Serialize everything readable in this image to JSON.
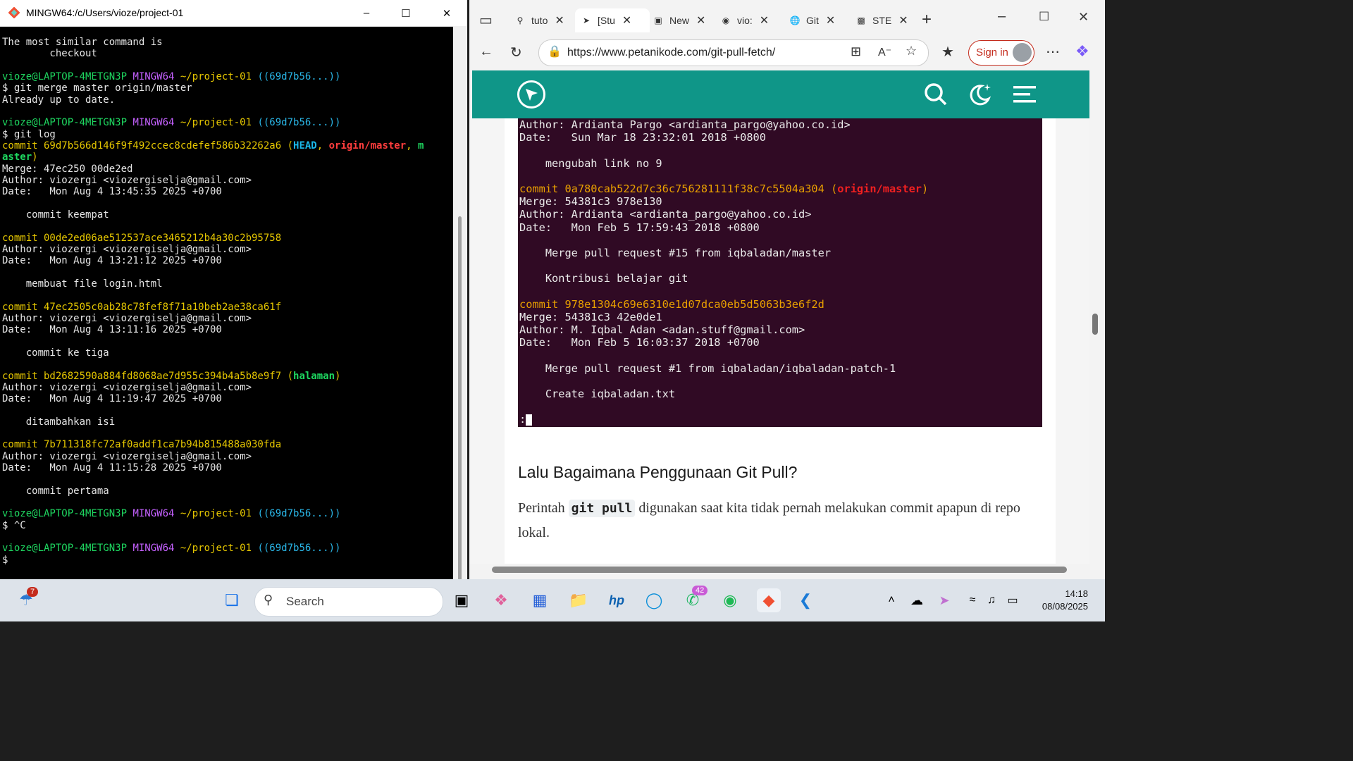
{
  "terminal": {
    "title": "MINGW64:/c/Users/vioze/project-01",
    "lines": [
      [
        [
          "The most similar command is",
          ""
        ]
      ],
      [
        [
          "        checkout",
          ""
        ]
      ],
      [
        [
          "",
          ""
        ]
      ],
      [
        [
          "vioze@LAPTOP-4METGN3P ",
          "c-user"
        ],
        [
          "MINGW64 ",
          "c-sys"
        ],
        [
          "~/project-01 ",
          "c-path"
        ],
        [
          "((69d7b56...))",
          "c-br"
        ]
      ],
      [
        [
          "$ git merge master origin/master",
          ""
        ]
      ],
      [
        [
          "Already up to date.",
          ""
        ]
      ],
      [
        [
          "",
          ""
        ]
      ],
      [
        [
          "vioze@LAPTOP-4METGN3P ",
          "c-user"
        ],
        [
          "MINGW64 ",
          "c-sys"
        ],
        [
          "~/project-01 ",
          "c-path"
        ],
        [
          "((69d7b56...))",
          "c-br"
        ]
      ],
      [
        [
          "$ git log",
          ""
        ]
      ],
      [
        [
          "commit 69d7b566d146f9f492ccec8cdefef586b32262a6 ",
          "c-yel"
        ],
        [
          "(",
          "c-yel"
        ],
        [
          "HEAD",
          "c-head"
        ],
        [
          ", ",
          "c-yel"
        ],
        [
          "origin/master",
          "c-orig"
        ],
        [
          ", ",
          "c-yel"
        ],
        [
          "m",
          "c-grn"
        ]
      ],
      [
        [
          "aster",
          "c-grn"
        ],
        [
          ")",
          "c-yel"
        ]
      ],
      [
        [
          "Merge: 47ec250 00de2ed",
          ""
        ]
      ],
      [
        [
          "Author: viozergi <viozergiselja@gmail.com>",
          ""
        ]
      ],
      [
        [
          "Date:   Mon Aug 4 13:45:35 2025 +0700",
          ""
        ]
      ],
      [
        [
          "",
          ""
        ]
      ],
      [
        [
          "    commit keempat",
          ""
        ]
      ],
      [
        [
          "",
          ""
        ]
      ],
      [
        [
          "commit 00de2ed06ae512537ace3465212b4a30c2b95758",
          "c-yel"
        ]
      ],
      [
        [
          "Author: viozergi <viozergiselja@gmail.com>",
          ""
        ]
      ],
      [
        [
          "Date:   Mon Aug 4 13:21:12 2025 +0700",
          ""
        ]
      ],
      [
        [
          "",
          ""
        ]
      ],
      [
        [
          "    membuat file login.html",
          ""
        ]
      ],
      [
        [
          "",
          ""
        ]
      ],
      [
        [
          "commit 47ec2505c0ab28c78fef8f71a10beb2ae38ca61f",
          "c-yel"
        ]
      ],
      [
        [
          "Author: viozergi <viozergiselja@gmail.com>",
          ""
        ]
      ],
      [
        [
          "Date:   Mon Aug 4 13:11:16 2025 +0700",
          ""
        ]
      ],
      [
        [
          "",
          ""
        ]
      ],
      [
        [
          "    commit ke tiga",
          ""
        ]
      ],
      [
        [
          "",
          ""
        ]
      ],
      [
        [
          "commit bd2682590a884fd8068ae7d955c394b4a5b8e9f7 ",
          "c-yel"
        ],
        [
          "(",
          "c-yel"
        ],
        [
          "halaman",
          "c-grn"
        ],
        [
          ")",
          "c-yel"
        ]
      ],
      [
        [
          "Author: viozergi <viozergiselja@gmail.com>",
          ""
        ]
      ],
      [
        [
          "Date:   Mon Aug 4 11:19:47 2025 +0700",
          ""
        ]
      ],
      [
        [
          "",
          ""
        ]
      ],
      [
        [
          "    ditambahkan isi",
          ""
        ]
      ],
      [
        [
          "",
          ""
        ]
      ],
      [
        [
          "commit 7b711318fc72af0addf1ca7b94b815488a030fda",
          "c-yel"
        ]
      ],
      [
        [
          "Author: viozergi <viozergiselja@gmail.com>",
          ""
        ]
      ],
      [
        [
          "Date:   Mon Aug 4 11:15:28 2025 +0700",
          ""
        ]
      ],
      [
        [
          "",
          ""
        ]
      ],
      [
        [
          "    commit pertama",
          ""
        ]
      ],
      [
        [
          "",
          ""
        ]
      ],
      [
        [
          "vioze@LAPTOP-4METGN3P ",
          "c-user"
        ],
        [
          "MINGW64 ",
          "c-sys"
        ],
        [
          "~/project-01 ",
          "c-path"
        ],
        [
          "((69d7b56...))",
          "c-br"
        ]
      ],
      [
        [
          "$ ^C",
          ""
        ]
      ],
      [
        [
          "",
          ""
        ]
      ],
      [
        [
          "vioze@LAPTOP-4METGN3P ",
          "c-user"
        ],
        [
          "MINGW64 ",
          "c-sys"
        ],
        [
          "~/project-01 ",
          "c-path"
        ],
        [
          "((69d7b56...))",
          "c-br"
        ]
      ],
      [
        [
          "$",
          ""
        ]
      ]
    ]
  },
  "browser": {
    "tabs": [
      {
        "label": "tuto",
        "icon": "search-icon"
      },
      {
        "label": "[Stu",
        "icon": "petanikode-icon"
      },
      {
        "label": "New",
        "icon": "newtab-icon"
      },
      {
        "label": "vio:",
        "icon": "github-icon"
      },
      {
        "label": "Git",
        "icon": "globe-icon"
      },
      {
        "label": "STE",
        "icon": "ste-icon"
      }
    ],
    "url": "https://www.petanikode.com/git-pull-fetch/",
    "signin": "Sign in",
    "terminal_shot": [
      [
        [
          "Author: Ardianta Pargo <ardianta_pargo@yahoo.co.id>",
          ""
        ]
      ],
      [
        [
          "Date:   Sun Mar 18 23:32:01 2018 +0800",
          ""
        ]
      ],
      [
        [
          "",
          ""
        ]
      ],
      [
        [
          "    mengubah link no 9",
          ""
        ]
      ],
      [
        [
          "",
          ""
        ]
      ],
      [
        [
          "commit 0a780cab522d7c36c756281111f38c7c5504a304 ",
          "u-yel"
        ],
        [
          "(",
          "u-yel"
        ],
        [
          "origin/master",
          "u-red"
        ],
        [
          ")",
          "u-yel"
        ]
      ],
      [
        [
          "Merge: 54381c3 978e130",
          ""
        ]
      ],
      [
        [
          "Author: Ardianta <ardianta_pargo@yahoo.co.id>",
          ""
        ]
      ],
      [
        [
          "Date:   Mon Feb 5 17:59:43 2018 +0800",
          ""
        ]
      ],
      [
        [
          "",
          ""
        ]
      ],
      [
        [
          "    Merge pull request #15 from iqbaladan/master",
          ""
        ]
      ],
      [
        [
          "",
          ""
        ]
      ],
      [
        [
          "    Kontribusi belajar git",
          ""
        ]
      ],
      [
        [
          "",
          ""
        ]
      ],
      [
        [
          "commit 978e1304c69e6310e1d07dca0eb5d5063b3e6f2d",
          "u-yel"
        ]
      ],
      [
        [
          "Merge: 54381c3 42e0de1",
          ""
        ]
      ],
      [
        [
          "Author: M. Iqbal Adan <adan.stuff@gmail.com>",
          ""
        ]
      ],
      [
        [
          "Date:   Mon Feb 5 16:03:37 2018 +0700",
          ""
        ]
      ],
      [
        [
          "",
          ""
        ]
      ],
      [
        [
          "    Merge pull request #1 from iqbaladan/iqbaladan-patch-1",
          ""
        ]
      ],
      [
        [
          "",
          ""
        ]
      ],
      [
        [
          "    Create iqbaladan.txt",
          ""
        ]
      ],
      [
        [
          "",
          ""
        ]
      ],
      [
        [
          ":",
          ""
        ]
      ]
    ],
    "heading": "Lalu Bagaimana Penggunaan Git Pull?",
    "para_before": "Perintah ",
    "para_code": "git pull",
    "para_after": " digunakan saat kita tidak pernah melakukan commit apapun di repo lokal."
  },
  "taskbar": {
    "search_placeholder": "Search",
    "weather_badge": "7",
    "whatsapp_badge": "42",
    "time": "14:18",
    "date": "08/08/2025"
  }
}
